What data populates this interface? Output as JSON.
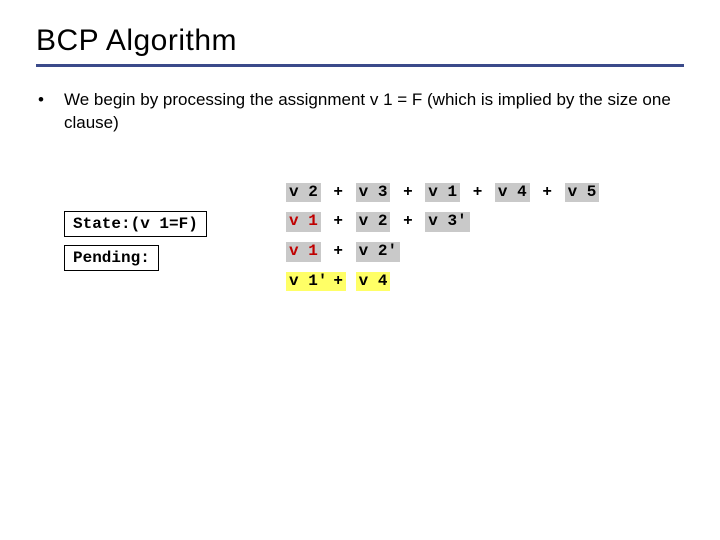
{
  "title": "BCP Algorithm",
  "bullet": "We begin by processing the assignment v 1 = F (which is implied by the size one clause)",
  "state_label": "State:(v 1=F)",
  "pending_label": "Pending:",
  "clauses": {
    "c1": {
      "a": "v 2",
      "p1": "+",
      "b": "v 3",
      "p2": "+",
      "c": "v 1",
      "p3": "+",
      "d": "v 4",
      "p4": "+",
      "e": "v 5"
    },
    "c2": {
      "a": "v 1",
      "p1": "+",
      "b": "v 2",
      "p2": "+",
      "c": "v 3'"
    },
    "c3": {
      "a": "v 1",
      "p1": "+",
      "b": "v 2'"
    },
    "c4": {
      "a": "v 1'",
      "p1": "+",
      "b": "v 4"
    }
  }
}
